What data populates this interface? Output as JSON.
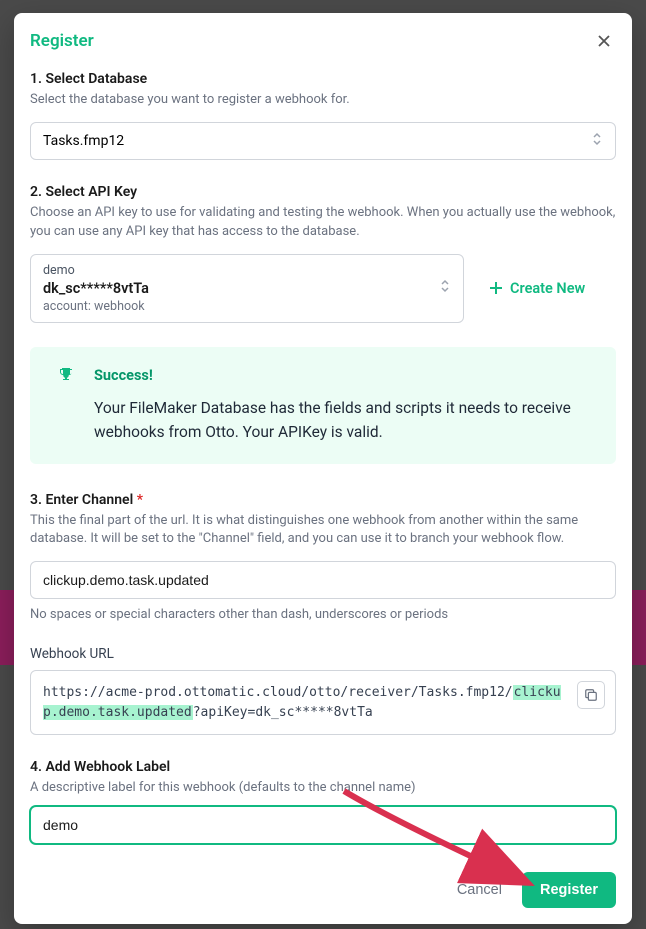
{
  "modal": {
    "title": "Register",
    "section1": {
      "title": "1. Select Database",
      "desc": "Select the database you want to register a webhook for.",
      "value": "Tasks.fmp12"
    },
    "section2": {
      "title": "2. Select API Key",
      "desc": "Choose an API key to use for validating and testing the webhook. When you actually use the webhook, you can use any API key that has access to the database.",
      "api_name": "demo",
      "api_key": "dk_sc*****8vtTa",
      "api_account": "account: webhook",
      "create_new_label": "Create New"
    },
    "alert": {
      "title": "Success!",
      "body": "Your FileMaker Database has the fields and scripts it needs to receive webhooks from Otto. Your APIKey is valid."
    },
    "section3": {
      "title": "3. Enter Channel ",
      "required_mark": "*",
      "desc": "This the final part of the url. It is what distinguishes one webhook from another within the same database. It will be set to the \"Channel\" field, and you can use it to branch your webhook flow.",
      "value": "clickup.demo.task.updated",
      "helper": "No spaces or special characters other than dash, underscores or periods"
    },
    "webhook_url": {
      "label": "Webhook URL",
      "prefix": "https://acme-prod.ottomatic.cloud/otto/receiver/Tasks.fmp12/",
      "channel": "clickup.demo.task.updated",
      "suffix": "?apiKey=dk_sc*****8vtTa"
    },
    "section4": {
      "title": "4. Add Webhook Label",
      "desc": "A descriptive label for this webhook (defaults to the channel name)",
      "value": "demo"
    },
    "footer": {
      "cancel": "Cancel",
      "register": "Register"
    }
  }
}
